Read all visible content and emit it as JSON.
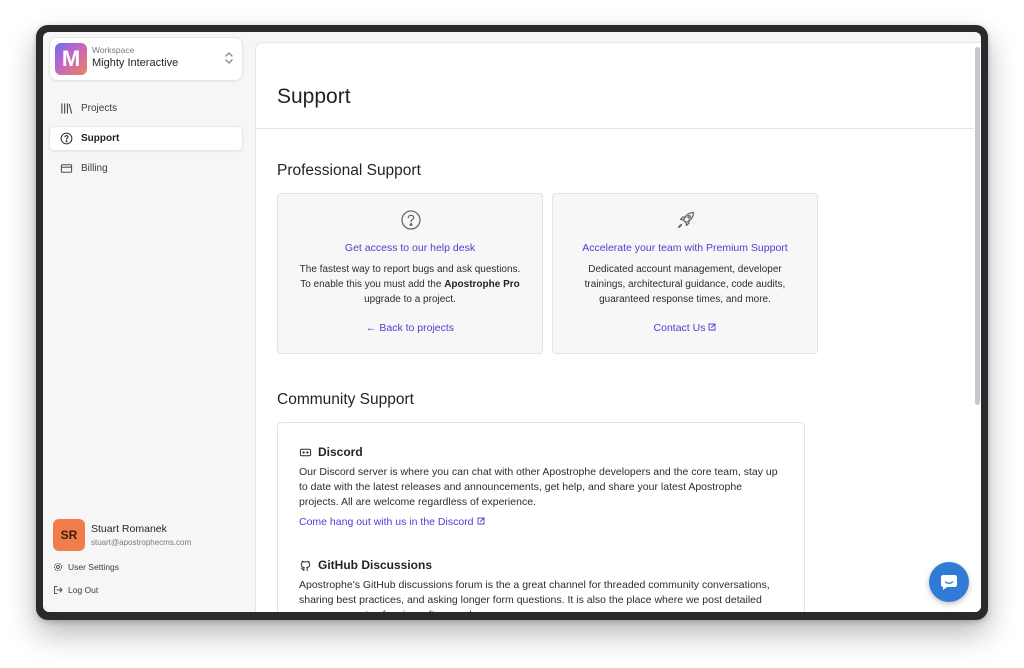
{
  "workspace": {
    "label": "Workspace",
    "name": "Mighty Interactive",
    "logo_letter": "M"
  },
  "nav": {
    "items": [
      {
        "label": "Projects",
        "icon": "library-icon",
        "active": false
      },
      {
        "label": "Support",
        "icon": "help-circle-icon",
        "active": true
      },
      {
        "label": "Billing",
        "icon": "credit-card-icon",
        "active": false
      }
    ]
  },
  "user": {
    "initials": "SR",
    "name": "Stuart Romanek",
    "email": "stuart@apostrophecms.com",
    "settings_label": "User Settings",
    "logout_label": "Log Out"
  },
  "page": {
    "title": "Support"
  },
  "professional": {
    "title": "Professional Support",
    "cards": [
      {
        "icon": "help-circle-icon",
        "title": "Get access to our help desk",
        "body_pre": "The fastest way to report bugs and ask questions. To enable this you must add the ",
        "body_bold": "Apostrophe Pro",
        "body_post": " upgrade to a project.",
        "link": "← Back to projects"
      },
      {
        "icon": "rocket-icon",
        "title": "Accelerate your team with Premium Support",
        "body": "Dedicated account management, developer trainings, architectural guidance, code audits, guaranteed response times, and more.",
        "link": "Contact Us"
      }
    ]
  },
  "community": {
    "title": "Community Support",
    "items": [
      {
        "icon": "discord-icon",
        "title": "Discord",
        "body": "Our Discord server is where you can chat with other Apostrophe developers and the core team, stay up to date with the latest releases and announcements, get help, and share your latest Apostrophe projects. All are welcome regardless of experience.",
        "link": "Come hang out with us in the Discord"
      },
      {
        "icon": "github-icon",
        "title": "GitHub Discussions",
        "body": "Apostrophe's GitHub discussions forum is the a great channel for threaded community conversations, sharing best practices, and asking longer form questions. It is also the place where we post detailed announcements of major software releases.",
        "link": ""
      }
    ]
  },
  "colors": {
    "accent": "#4b3fd0",
    "chat_button": "#2f7bd6",
    "avatar": "#f07d4a"
  }
}
